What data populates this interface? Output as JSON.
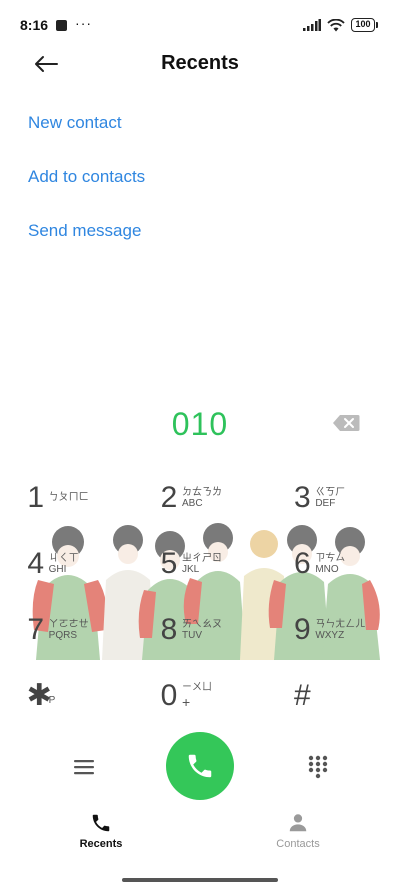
{
  "status_bar": {
    "time": "8:16",
    "overflow": "···",
    "battery": "100",
    "icons": [
      "notification-square-icon",
      "cellular-signal-icon",
      "wifi-icon",
      "battery-icon"
    ]
  },
  "header": {
    "title": "Recents",
    "back_icon": "arrow-left-icon"
  },
  "actions": [
    {
      "label": "New contact"
    },
    {
      "label": "Add to contacts"
    },
    {
      "label": "Send message"
    }
  ],
  "dialer": {
    "number": "010",
    "backspace_icon": "backspace-icon"
  },
  "keypad": [
    {
      "digit": "1",
      "zhuyin": "ㄅㄆㄇㄈ",
      "letters": ""
    },
    {
      "digit": "2",
      "zhuyin": "ㄉㄊㄋㄌ",
      "letters": "ABC"
    },
    {
      "digit": "3",
      "zhuyin": "ㄍㄎㄏ",
      "letters": "DEF"
    },
    {
      "digit": "4",
      "zhuyin": "ㄐㄑㄒ",
      "letters": "GHI"
    },
    {
      "digit": "5",
      "zhuyin": "ㄓㄔㄕㄖ",
      "letters": "JKL"
    },
    {
      "digit": "6",
      "zhuyin": "ㄗㄘㄙ",
      "letters": "MNO"
    },
    {
      "digit": "7",
      "zhuyin": "ㄚㄛㄜㄝ",
      "letters": "PQRS"
    },
    {
      "digit": "8",
      "zhuyin": "ㄞㄟㄠㄡ",
      "letters": "TUV"
    },
    {
      "digit": "9",
      "zhuyin": "ㄢㄣㄤㄥㄦ",
      "letters": "WXYZ"
    },
    {
      "digit": "✱",
      "zhuyin": "",
      "letters": "P"
    },
    {
      "digit": "0",
      "zhuyin": "ㄧㄨㄩ",
      "letters": "+"
    },
    {
      "digit": "#",
      "zhuyin": "",
      "letters": ""
    }
  ],
  "controls": {
    "menu_icon": "hamburger-menu-icon",
    "call_icon": "phone-icon",
    "keypad_icon": "dialpad-grid-icon",
    "call_color": "#34c759"
  },
  "bottom_nav": {
    "recents_label": "Recents",
    "contacts_label": "Contacts"
  },
  "colors": {
    "accent_blue": "#2f86e0",
    "number_green": "#2ec25b"
  }
}
